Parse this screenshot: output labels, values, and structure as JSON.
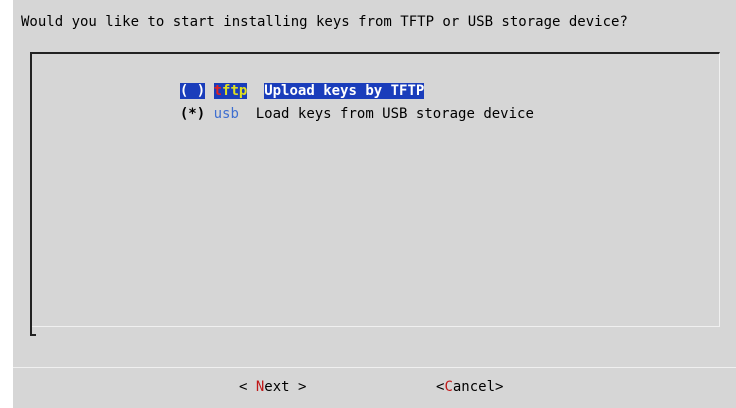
{
  "dialog": {
    "prompt": "Would you like to start installing keys from TFTP or USB storage device?"
  },
  "menu": {
    "items": [
      {
        "radio": "( )",
        "tag_hotkey": "t",
        "tag_rest": "ftp",
        "description": "Upload keys by TFTP",
        "selected_highlight": true
      },
      {
        "radio": "(*)",
        "tag_hotkey": "",
        "tag_rest": "usb",
        "description": "Load keys from USB storage device",
        "selected_highlight": false
      }
    ]
  },
  "buttons": {
    "next": {
      "prefix": "< ",
      "hotkey": "N",
      "rest": "ext",
      "suffix": " >"
    },
    "cancel": {
      "prefix": "<",
      "hotkey": "C",
      "rest": "ancel",
      "suffix": ">"
    }
  },
  "colors": {
    "dialog_bg": "#d6d6d6",
    "highlight_bg": "#1a3dbb",
    "hotkey_red": "#c01818",
    "tag_yellow": "#e0e020",
    "tag_blue": "#3f6fd0"
  }
}
